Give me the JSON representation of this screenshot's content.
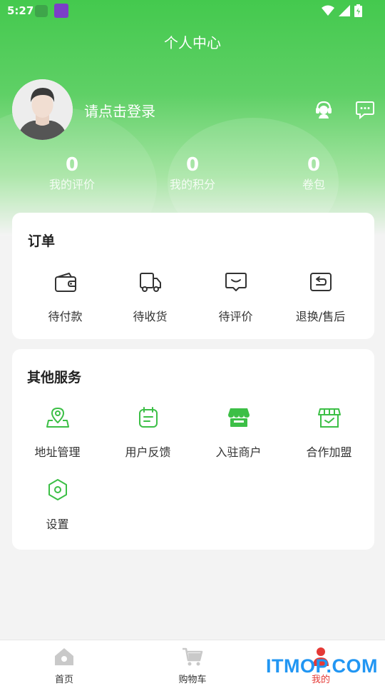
{
  "status_bar": {
    "time": "5:27"
  },
  "header": {
    "title": "个人中心"
  },
  "profile": {
    "login_prompt": "请点击登录"
  },
  "stats": [
    {
      "value": "0",
      "label": "我的评价"
    },
    {
      "value": "0",
      "label": "我的积分"
    },
    {
      "value": "0",
      "label": "卷包"
    }
  ],
  "orders": {
    "title": "订单",
    "items": [
      {
        "label": "待付款",
        "icon": "wallet-icon"
      },
      {
        "label": "待收货",
        "icon": "truck-icon"
      },
      {
        "label": "待评价",
        "icon": "comment-icon"
      },
      {
        "label": "退换/售后",
        "icon": "return-icon"
      }
    ]
  },
  "services": {
    "title": "其他服务",
    "items": [
      {
        "label": "地址管理",
        "icon": "location-icon"
      },
      {
        "label": "用户反馈",
        "icon": "feedback-icon"
      },
      {
        "label": "入驻商户",
        "icon": "store-icon"
      },
      {
        "label": "合作加盟",
        "icon": "shop-icon"
      },
      {
        "label": "设置",
        "icon": "settings-icon"
      }
    ]
  },
  "tabbar": {
    "items": [
      {
        "label": "首页",
        "icon": "home-icon"
      },
      {
        "label": "购物车",
        "icon": "cart-icon"
      },
      {
        "label": "我的",
        "icon": "user-icon",
        "active": true
      }
    ]
  },
  "watermark": "ITMOP.COM",
  "colors": {
    "accent": "#44c94e",
    "active_tab": "#e53935",
    "watermark": "#2196f3"
  }
}
